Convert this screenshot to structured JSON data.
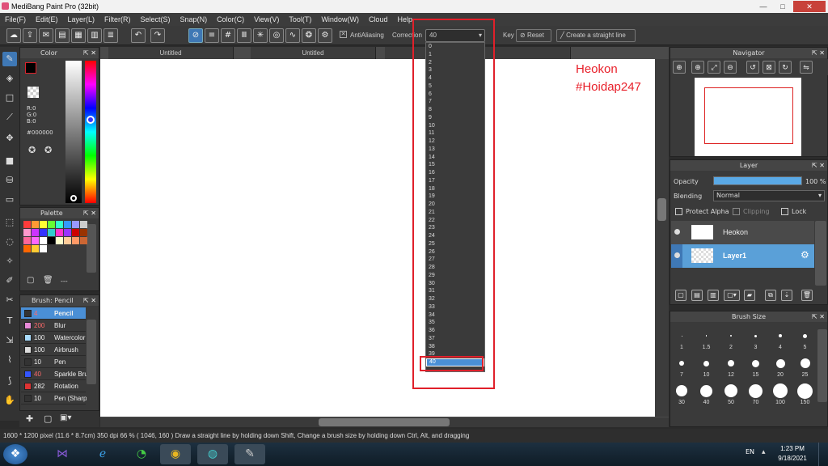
{
  "window": {
    "title": "MediBang Paint Pro (32bit)",
    "minimize": "—",
    "maximize": "□",
    "close": "✕"
  },
  "menu": [
    "File(F)",
    "Edit(E)",
    "Layer(L)",
    "Filter(R)",
    "Select(S)",
    "Snap(N)",
    "Color(C)",
    "View(V)",
    "Tool(T)",
    "Window(W)",
    "Cloud",
    "Help"
  ],
  "toolbar": {
    "antialiasing_label": "AntiAliasing",
    "correction_label": "Correction",
    "correction_value": "40",
    "key_label": "Key",
    "reset_label": "Reset",
    "straight_line_label": "Create a straight line"
  },
  "correction_options": [
    "0",
    "1",
    "2",
    "3",
    "4",
    "5",
    "6",
    "7",
    "8",
    "9",
    "10",
    "11",
    "12",
    "13",
    "14",
    "15",
    "16",
    "17",
    "18",
    "19",
    "20",
    "21",
    "22",
    "23",
    "24",
    "25",
    "26",
    "27",
    "28",
    "29",
    "30",
    "31",
    "32",
    "33",
    "34",
    "35",
    "36",
    "37",
    "38",
    "39",
    "40"
  ],
  "tabs": [
    "Untitled",
    "Untitled"
  ],
  "watermark": {
    "line1": "Heokon",
    "line2": "#Hoidap247"
  },
  "color_panel": {
    "title": "Color",
    "r": "R:0",
    "g": "G:0",
    "b": "B:0",
    "hex": "#000000"
  },
  "palette_panel": {
    "title": "Palette",
    "footer": "---"
  },
  "palette_colors": [
    "#ff3b3b",
    "#ff9933",
    "#ffff33",
    "#66ff33",
    "#33ffcc",
    "#3399ff",
    "#9999ff",
    "#cccccc",
    "#ff99cc",
    "#cc33ff",
    "#3333ff",
    "#33cccc",
    "#ff33cc",
    "#9933ff",
    "#cc0000",
    "#993300",
    "#ff6699",
    "#ff66ff",
    "#ffffff",
    "#000000",
    "#ffffcc",
    "#ffcc99",
    "#ff9966",
    "#cc6633",
    "#ff6600",
    "#ffcc33",
    "#ffffff"
  ],
  "brush_panel": {
    "title": "Brush: Pencil",
    "items": [
      {
        "size": "4",
        "name": "Pencil",
        "color": "#333333",
        "selected": true
      },
      {
        "size": "200",
        "name": "Blur",
        "color": "#e88ad8"
      },
      {
        "size": "100",
        "name": "Watercolor",
        "color": "#aaddff"
      },
      {
        "size": "100",
        "name": "Airbrush",
        "color": "#dddddd"
      },
      {
        "size": "10",
        "name": "Pen",
        "color": "#333333"
      },
      {
        "size": "40",
        "name": "Sparkle Brush",
        "color": "#3355ff"
      },
      {
        "size": "282",
        "name": "Rotation",
        "color": "#dd3333"
      },
      {
        "size": "10",
        "name": "Pen (Sharp)",
        "color": "#333333"
      }
    ]
  },
  "navigator": {
    "title": "Navigator"
  },
  "layer_panel": {
    "title": "Layer",
    "opacity_label": "Opacity",
    "opacity_value": "100 %",
    "opacity_fraction": 1.0,
    "blending_label": "Blending",
    "blending_value": "Normal",
    "protect_alpha": "Protect Alpha",
    "clipping": "Clipping",
    "lock": "Lock",
    "layers": [
      {
        "name": "Heokon",
        "selected": false
      },
      {
        "name": "Layer1",
        "selected": true
      }
    ]
  },
  "brush_size_panel": {
    "title": "Brush Size",
    "sizes": [
      "1",
      "1.5",
      "2",
      "3",
      "4",
      "5",
      "7",
      "10",
      "12",
      "15",
      "20",
      "25",
      "30",
      "40",
      "50",
      "70",
      "100",
      "150"
    ]
  },
  "statusbar": {
    "dimensions": "1600 * 1200 pixel",
    "physical": "(11.6 * 8.7cm)",
    "dpi": "350 dpi",
    "zoom": "66 %",
    "coords": "( 1046, 160 )",
    "hint": "Draw a straight line by holding down Shift, Change a brush size by holding down Ctrl, Alt, and dragging"
  },
  "taskbar": {
    "lang": "EN",
    "time": "1:23 PM",
    "date": "9/18/2021"
  },
  "colors": {
    "accent": "#3f78b5",
    "highlight_red": "#e0202a",
    "watermark_red": "#e8202a"
  }
}
